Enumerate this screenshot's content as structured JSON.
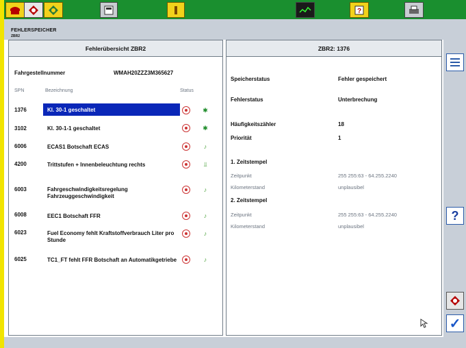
{
  "toolbar": {
    "icons": [
      "vehicle-icon",
      "diagnosis-icon",
      "component-icon",
      "calculator-icon",
      "info-icon",
      "graph-icon",
      "help-book-icon",
      "printer-icon"
    ]
  },
  "subheader": {
    "title": "FEHLERSPEICHER",
    "subtitle": "ZBR2"
  },
  "left_panel": {
    "title": "Fehlerübersicht  ZBR2",
    "vin_label": "Fahrgestellnummer",
    "vin_value": "WMAH20ZZZ3M365627",
    "col_spn": "SPN",
    "col_desc": "Bezeichnung",
    "col_status": "Status",
    "rows": [
      {
        "spn": "1376",
        "desc": "Kl. 30-1 geschaltet",
        "selected": true
      },
      {
        "spn": "3102",
        "desc": "Kl. 30-1-1 geschaltet"
      },
      {
        "spn": "6006",
        "desc": "ECAS1 Botschaft ECAS"
      },
      {
        "spn": "4200",
        "desc": "Trittstufen + Innenbeleuchtung rechts"
      },
      {
        "spn": "6003",
        "desc": "Fahrgeschwindigkeitsregelung Fahrzeuggeschwindigkeit"
      },
      {
        "spn": "6008",
        "desc": "EEC1 Botschaft FFR"
      },
      {
        "spn": "6023",
        "desc": "Fuel Economy fehlt Kraftstoffverbrauch Liter pro Stunde"
      },
      {
        "spn": "6025",
        "desc": "TC1_FT fehlt FFR Botschaft an Automatikgetriebe"
      }
    ]
  },
  "right_panel": {
    "title": "ZBR2: 1376",
    "speicherstatus_label": "Speicherstatus",
    "speicherstatus_value": "Fehler gespeichert",
    "fehlerstatus_label": "Fehlerstatus",
    "fehlerstatus_value": "Unterbrechung",
    "haeufigkeit_label": "Häufigkeitszähler",
    "haeufigkeit_value": "18",
    "prioritaet_label": "Priorität",
    "prioritaet_value": "1",
    "zs1_label": "1. Zeitstempel",
    "zs1_zeit_label": "Zeitpunkt",
    "zs1_zeit_value": "255 255:63  -  64.255.2240",
    "zs1_km_label": "Kilometerstand",
    "zs1_km_value": "unplausibel",
    "zs2_label": "2. Zeitstempel",
    "zs2_zeit_label": "Zeitpunkt",
    "zs2_zeit_value": "255 255:63  -  64.255.2240",
    "zs2_km_label": "Kilometerstand",
    "zs2_km_value": "unplausibel"
  },
  "right_buttons": {
    "help_label": "?",
    "ok_label": "✓"
  }
}
